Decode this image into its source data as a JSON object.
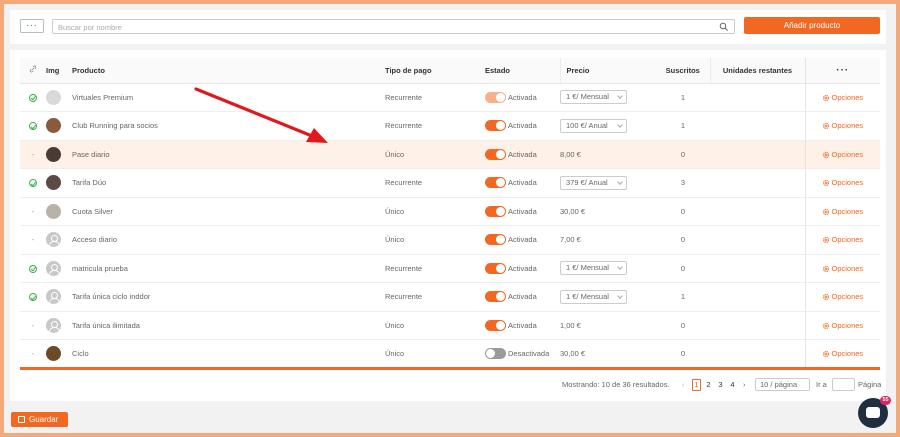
{
  "toolbar": {
    "menu_label": "···",
    "search_placeholder": "Buscar por nombre",
    "add_label": "Añadir producto"
  },
  "table": {
    "headers": {
      "img": "Img",
      "producto": "Producto",
      "tipo": "Tipo de pago",
      "estado": "Estado",
      "precio": "Precio",
      "suscritos": "Suscritos",
      "unidades": "Unidades restantes",
      "more": "···"
    },
    "rows": [
      {
        "mark": "check",
        "name": "Virtuales Premium",
        "tipo": "Recurrente",
        "estado": "Activada",
        "toggle": "light",
        "precio": "1 €/ Mensual",
        "precio_select": true,
        "suscritos": "1",
        "opciones": "Opciones",
        "thumb": "phone"
      },
      {
        "mark": "check",
        "name": "Club Running para socios",
        "tipo": "Recurrente",
        "estado": "Activada",
        "toggle": "on",
        "precio": "100 €/ Anual",
        "precio_select": true,
        "suscritos": "1",
        "opciones": "Opciones",
        "thumb": "photo-a"
      },
      {
        "mark": "-",
        "name": "Pase diario",
        "tipo": "Único",
        "estado": "Activada",
        "toggle": "on",
        "precio": "8,00 €",
        "precio_select": false,
        "suscritos": "0",
        "opciones": "Opciones",
        "thumb": "photo-b"
      },
      {
        "mark": "check",
        "name": "Tarifa Dúo",
        "tipo": "Recurrente",
        "estado": "Activada",
        "toggle": "on",
        "precio": "379 €/ Anual",
        "precio_select": true,
        "suscritos": "3",
        "opciones": "Opciones",
        "thumb": "photo-c"
      },
      {
        "mark": "-",
        "name": "Cuota Silver",
        "tipo": "Único",
        "estado": "Activada",
        "toggle": "on",
        "precio": "30,00 €",
        "precio_select": false,
        "suscritos": "0",
        "opciones": "Opciones",
        "thumb": "photo-d"
      },
      {
        "mark": "-",
        "name": "Acceso diario",
        "tipo": "Único",
        "estado": "Activada",
        "toggle": "on",
        "precio": "7,00 €",
        "precio_select": false,
        "suscritos": "0",
        "opciones": "Opciones",
        "thumb": "placeholder"
      },
      {
        "mark": "check",
        "name": "matricula prueba",
        "tipo": "Recurrente",
        "estado": "Activada",
        "toggle": "on",
        "precio": "1 €/ Mensual",
        "precio_select": true,
        "suscritos": "0",
        "opciones": "Opciones",
        "thumb": "placeholder"
      },
      {
        "mark": "check",
        "name": "Tarifa única ciclo inddor",
        "tipo": "Recurrente",
        "estado": "Activada",
        "toggle": "on",
        "precio": "1 €/ Mensual",
        "precio_select": true,
        "suscritos": "1",
        "opciones": "Opciones",
        "thumb": "placeholder"
      },
      {
        "mark": "-",
        "name": "Tarifa única ilimitada",
        "tipo": "Único",
        "estado": "Activada",
        "toggle": "on",
        "precio": "1,00 €",
        "precio_select": false,
        "suscritos": "0",
        "opciones": "Opciones",
        "thumb": "placeholder"
      },
      {
        "mark": "-",
        "name": "Ciclo",
        "tipo": "Único",
        "estado": "Desactivada",
        "toggle": "off",
        "precio": "30,00 €",
        "precio_select": false,
        "suscritos": "0",
        "opciones": "Opciones",
        "thumb": "photo-e"
      }
    ]
  },
  "pagination": {
    "summary": "Mostrando: 10 de 36 resultados.",
    "prev": "‹",
    "pages": [
      "1",
      "2",
      "3",
      "4"
    ],
    "current": "1",
    "next": "›",
    "per_page": "10 / página",
    "goto_label": "Ir a",
    "page_label": "Página"
  },
  "footer": {
    "save_label": "Guardar",
    "chat_badge": "55"
  },
  "colors": {
    "accent": "#f26722",
    "border": "#f3a97a",
    "check": "#3bb54a",
    "arrow": "#e0191c"
  }
}
